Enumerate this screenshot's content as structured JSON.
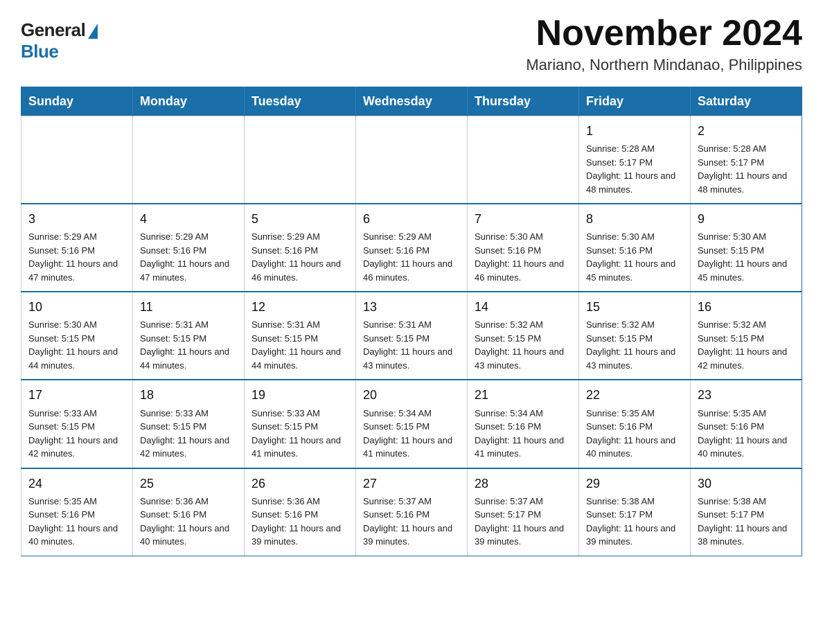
{
  "logo": {
    "general": "General",
    "blue": "Blue"
  },
  "title": {
    "month_year": "November 2024",
    "location": "Mariano, Northern Mindanao, Philippines"
  },
  "days_of_week": [
    "Sunday",
    "Monday",
    "Tuesday",
    "Wednesday",
    "Thursday",
    "Friday",
    "Saturday"
  ],
  "weeks": [
    [
      {
        "day": "",
        "info": ""
      },
      {
        "day": "",
        "info": ""
      },
      {
        "day": "",
        "info": ""
      },
      {
        "day": "",
        "info": ""
      },
      {
        "day": "",
        "info": ""
      },
      {
        "day": "1",
        "info": "Sunrise: 5:28 AM\nSunset: 5:17 PM\nDaylight: 11 hours and 48 minutes."
      },
      {
        "day": "2",
        "info": "Sunrise: 5:28 AM\nSunset: 5:17 PM\nDaylight: 11 hours and 48 minutes."
      }
    ],
    [
      {
        "day": "3",
        "info": "Sunrise: 5:29 AM\nSunset: 5:16 PM\nDaylight: 11 hours and 47 minutes."
      },
      {
        "day": "4",
        "info": "Sunrise: 5:29 AM\nSunset: 5:16 PM\nDaylight: 11 hours and 47 minutes."
      },
      {
        "day": "5",
        "info": "Sunrise: 5:29 AM\nSunset: 5:16 PM\nDaylight: 11 hours and 46 minutes."
      },
      {
        "day": "6",
        "info": "Sunrise: 5:29 AM\nSunset: 5:16 PM\nDaylight: 11 hours and 46 minutes."
      },
      {
        "day": "7",
        "info": "Sunrise: 5:30 AM\nSunset: 5:16 PM\nDaylight: 11 hours and 46 minutes."
      },
      {
        "day": "8",
        "info": "Sunrise: 5:30 AM\nSunset: 5:16 PM\nDaylight: 11 hours and 45 minutes."
      },
      {
        "day": "9",
        "info": "Sunrise: 5:30 AM\nSunset: 5:15 PM\nDaylight: 11 hours and 45 minutes."
      }
    ],
    [
      {
        "day": "10",
        "info": "Sunrise: 5:30 AM\nSunset: 5:15 PM\nDaylight: 11 hours and 44 minutes."
      },
      {
        "day": "11",
        "info": "Sunrise: 5:31 AM\nSunset: 5:15 PM\nDaylight: 11 hours and 44 minutes."
      },
      {
        "day": "12",
        "info": "Sunrise: 5:31 AM\nSunset: 5:15 PM\nDaylight: 11 hours and 44 minutes."
      },
      {
        "day": "13",
        "info": "Sunrise: 5:31 AM\nSunset: 5:15 PM\nDaylight: 11 hours and 43 minutes."
      },
      {
        "day": "14",
        "info": "Sunrise: 5:32 AM\nSunset: 5:15 PM\nDaylight: 11 hours and 43 minutes."
      },
      {
        "day": "15",
        "info": "Sunrise: 5:32 AM\nSunset: 5:15 PM\nDaylight: 11 hours and 43 minutes."
      },
      {
        "day": "16",
        "info": "Sunrise: 5:32 AM\nSunset: 5:15 PM\nDaylight: 11 hours and 42 minutes."
      }
    ],
    [
      {
        "day": "17",
        "info": "Sunrise: 5:33 AM\nSunset: 5:15 PM\nDaylight: 11 hours and 42 minutes."
      },
      {
        "day": "18",
        "info": "Sunrise: 5:33 AM\nSunset: 5:15 PM\nDaylight: 11 hours and 42 minutes."
      },
      {
        "day": "19",
        "info": "Sunrise: 5:33 AM\nSunset: 5:15 PM\nDaylight: 11 hours and 41 minutes."
      },
      {
        "day": "20",
        "info": "Sunrise: 5:34 AM\nSunset: 5:15 PM\nDaylight: 11 hours and 41 minutes."
      },
      {
        "day": "21",
        "info": "Sunrise: 5:34 AM\nSunset: 5:16 PM\nDaylight: 11 hours and 41 minutes."
      },
      {
        "day": "22",
        "info": "Sunrise: 5:35 AM\nSunset: 5:16 PM\nDaylight: 11 hours and 40 minutes."
      },
      {
        "day": "23",
        "info": "Sunrise: 5:35 AM\nSunset: 5:16 PM\nDaylight: 11 hours and 40 minutes."
      }
    ],
    [
      {
        "day": "24",
        "info": "Sunrise: 5:35 AM\nSunset: 5:16 PM\nDaylight: 11 hours and 40 minutes."
      },
      {
        "day": "25",
        "info": "Sunrise: 5:36 AM\nSunset: 5:16 PM\nDaylight: 11 hours and 40 minutes."
      },
      {
        "day": "26",
        "info": "Sunrise: 5:36 AM\nSunset: 5:16 PM\nDaylight: 11 hours and 39 minutes."
      },
      {
        "day": "27",
        "info": "Sunrise: 5:37 AM\nSunset: 5:16 PM\nDaylight: 11 hours and 39 minutes."
      },
      {
        "day": "28",
        "info": "Sunrise: 5:37 AM\nSunset: 5:17 PM\nDaylight: 11 hours and 39 minutes."
      },
      {
        "day": "29",
        "info": "Sunrise: 5:38 AM\nSunset: 5:17 PM\nDaylight: 11 hours and 39 minutes."
      },
      {
        "day": "30",
        "info": "Sunrise: 5:38 AM\nSunset: 5:17 PM\nDaylight: 11 hours and 38 minutes."
      }
    ]
  ]
}
